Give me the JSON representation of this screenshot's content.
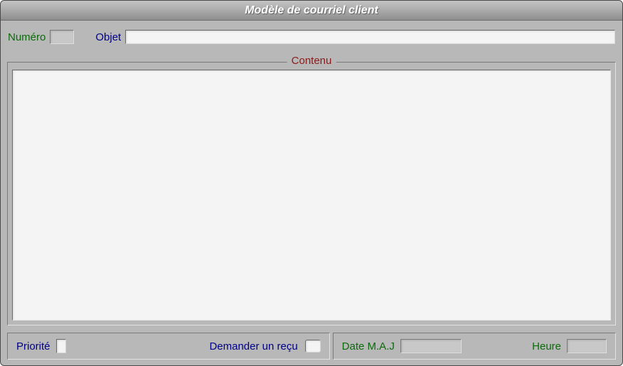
{
  "window": {
    "title": "Modèle de courriel client"
  },
  "top": {
    "numero_label": "Numéro",
    "numero_value": "",
    "objet_label": "Objet",
    "objet_value": ""
  },
  "content": {
    "legend": "Contenu",
    "body": ""
  },
  "bottom": {
    "priorite_label": "Priorité",
    "priorite_value": "",
    "receipt_label": "Demander un reçu",
    "receipt_checked": false,
    "date_label": "Date M.A.J",
    "date_value": "",
    "heure_label": "Heure",
    "heure_value": ""
  }
}
